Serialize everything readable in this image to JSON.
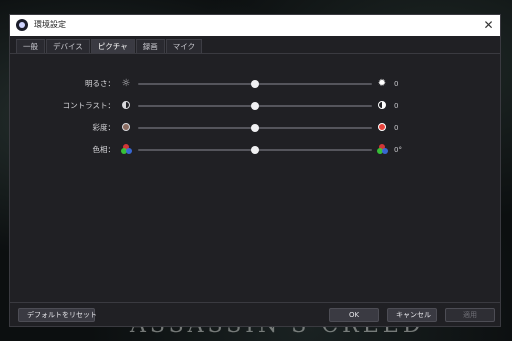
{
  "background": {
    "title": "ASSASSIN'S CREED"
  },
  "window": {
    "title": "環境設定",
    "icon": "app-logo-icon",
    "close": "✕"
  },
  "tabs": [
    {
      "label": "一般",
      "active": false
    },
    {
      "label": "デバイス",
      "active": false
    },
    {
      "label": "ピクチャ",
      "active": true
    },
    {
      "label": "録画",
      "active": false
    },
    {
      "label": "マイク",
      "active": false
    }
  ],
  "settings": [
    {
      "name": "brightness",
      "label": "明るさ：",
      "value": "0",
      "level": 0.5,
      "icon_low": "sun-outline-icon",
      "icon_high": "sun-filled-icon"
    },
    {
      "name": "contrast",
      "label": "コントラスト：",
      "value": "0",
      "level": 0.5,
      "icon_low": "contrast-low-icon",
      "icon_high": "contrast-high-icon"
    },
    {
      "name": "saturation",
      "label": "彩度：",
      "value": "0",
      "level": 0.5,
      "icon_low": "saturation-low-icon",
      "icon_high": "saturation-high-icon"
    },
    {
      "name": "hue",
      "label": "色相：",
      "value": "0°",
      "level": 0.5,
      "icon_low": "hue-rgb-icon",
      "icon_high": "hue-rgb-icon"
    }
  ],
  "footer": {
    "reset": "デフォルトをリセット",
    "ok": "OK",
    "cancel": "キャンセル",
    "apply": "適用"
  },
  "colors": {
    "dialog_bg": "#202024",
    "titlebar_bg": "#ffffff",
    "accent": "#f0f0f2"
  }
}
